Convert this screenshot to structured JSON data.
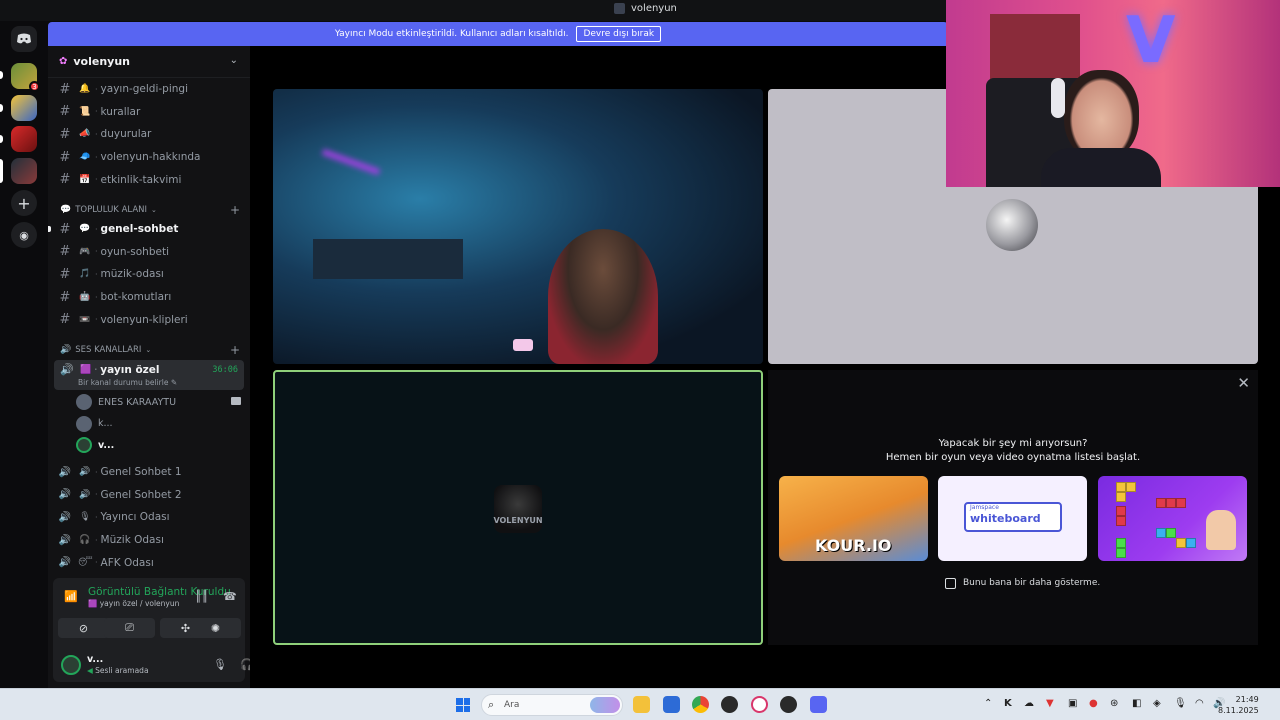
{
  "window": {
    "title": "volenyun"
  },
  "banner": {
    "text": "Yayıncı Modu etkinleştirildi. Kullanıcı adları kısaltıldı.",
    "button": "Devre dışı bırak"
  },
  "server": {
    "name": "volenyun"
  },
  "channels_top": [
    {
      "emoji": "🔔",
      "label": "yayın-geldi-pingi",
      "icon": "hash-icon"
    },
    {
      "emoji": "📜",
      "label": "kurallar",
      "icon": "rules-icon"
    },
    {
      "emoji": "📣",
      "label": "duyurular",
      "icon": "hash-icon"
    },
    {
      "emoji": "🧢",
      "label": "volenyun-hakkında",
      "icon": "hash-icon"
    },
    {
      "emoji": "📅",
      "label": "etkinlik-takvimi",
      "icon": "hash-icon"
    }
  ],
  "community": {
    "category": "TOPLULUK ALANI",
    "channels": [
      {
        "emoji": "💬",
        "label": "genel-sohbet",
        "active": true
      },
      {
        "emoji": "🎮",
        "label": "oyun-sohbeti"
      },
      {
        "emoji": "🎵",
        "label": "müzik-odası"
      },
      {
        "emoji": "🤖",
        "label": "bot-komutları"
      },
      {
        "emoji": "📼",
        "label": "volenyun-klipleri"
      }
    ]
  },
  "voice": {
    "category": "SES KANALLARI",
    "active_channel": {
      "label": "yayın özel",
      "timer": "36:06",
      "status": "Bir kanal durumu belirle"
    },
    "users": [
      {
        "name": "ENES KARAAYTU",
        "camera": true
      },
      {
        "name": "k..."
      },
      {
        "name": "v..."
      }
    ],
    "channels": [
      {
        "emoji": "🔊",
        "label": "Genel Sohbet 1"
      },
      {
        "emoji": "🔊",
        "label": "Genel Sohbet 2"
      },
      {
        "emoji": "🎙",
        "label": "Yayıncı Odası"
      },
      {
        "emoji": "🎧",
        "label": "Müzik Odası"
      },
      {
        "emoji": "😴",
        "label": "AFK Odası"
      }
    ]
  },
  "rtc": {
    "status": "Görüntülü Bağlantı Kuruldu",
    "channel": "yayın özel / volenyun"
  },
  "user": {
    "name": "v...",
    "status": "Sesli aramada"
  },
  "activity": {
    "question": "Yapacak bir şey mi arıyorsun?",
    "prompt": "Hemen bir oyun veya video oynatma listesi başlat.",
    "cards": [
      {
        "title": "KOUR.IO"
      },
      {
        "subtitle": "Jamspace",
        "title": "whiteboard"
      },
      {
        "title": ""
      }
    ],
    "checkbox_label": "Bunu bana bir daha gösterme."
  },
  "tiles": {
    "self_logo": "VOLENYUN"
  },
  "taskbar": {
    "search_placeholder": "Ara",
    "time": "21:49",
    "date": "8.11.2025"
  },
  "colors": {
    "accent": "#5865f2",
    "online": "#23a55a",
    "sidebar": "#121214",
    "rail": "#0b0b0d"
  }
}
